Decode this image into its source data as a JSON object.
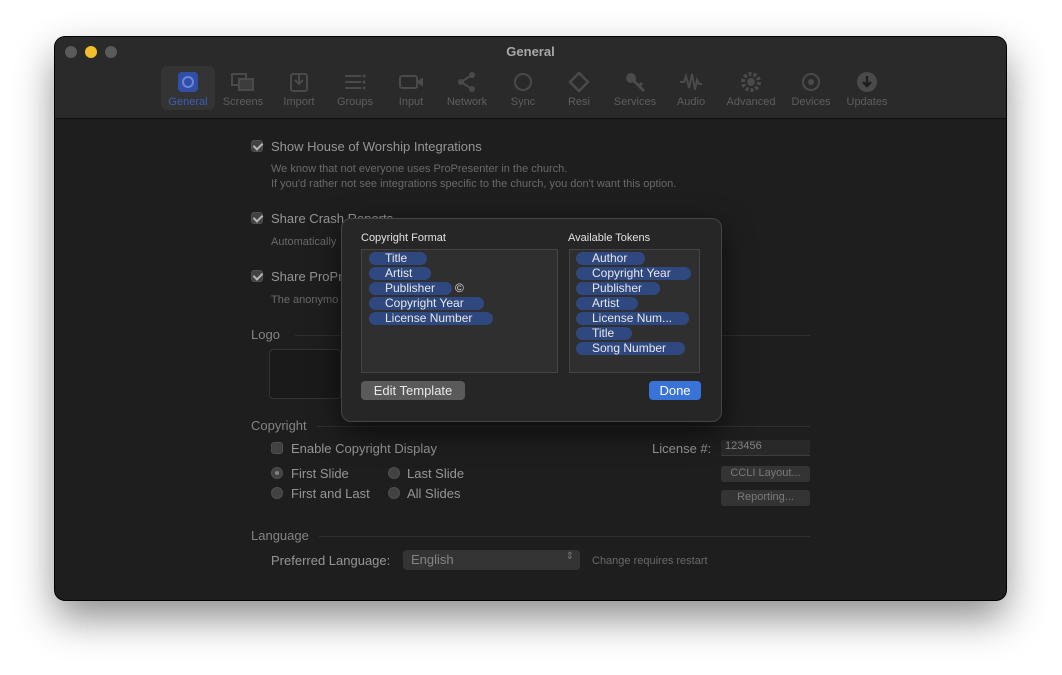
{
  "window": {
    "title": "General"
  },
  "toolbar": {
    "items": [
      {
        "label": "General",
        "icon": "gear-square-icon",
        "selected": true
      },
      {
        "label": "Screens",
        "icon": "screens-icon"
      },
      {
        "label": "Import",
        "icon": "import-icon"
      },
      {
        "label": "Groups",
        "icon": "groups-icon"
      },
      {
        "label": "Input",
        "icon": "video-input-icon"
      },
      {
        "label": "Network",
        "icon": "network-icon"
      },
      {
        "label": "Sync",
        "icon": "sync-icon"
      },
      {
        "label": "Resi",
        "icon": "resi-icon"
      },
      {
        "label": "Services",
        "icon": "key-icon"
      },
      {
        "label": "Audio",
        "icon": "waveform-icon"
      },
      {
        "label": "Advanced",
        "icon": "gear-icon"
      },
      {
        "label": "Devices",
        "icon": "devices-icon"
      },
      {
        "label": "Updates",
        "icon": "download-icon"
      }
    ]
  },
  "general": {
    "house_of_worship": {
      "label": "Show House of Worship Integrations",
      "checked": true,
      "desc1": "We know that not everyone uses ProPresenter in the church.",
      "desc2": "If you'd rather not see integrations specific to the church, you don't want this option."
    },
    "crash_reports": {
      "label": "Share Crash Reports",
      "checked": true,
      "desc": "Automatically"
    },
    "share_pro": {
      "label": "Share ProPr",
      "checked": true,
      "desc": "The anonymo"
    },
    "logo": {
      "title": "Logo"
    },
    "copyright": {
      "title": "Copyright",
      "enable_label": "Enable Copyright Display",
      "license_label": "License #:",
      "license_value": "123456",
      "first_slide": "First Slide",
      "last_slide": "Last Slide",
      "first_and_last": "First and Last",
      "all_slides": "All Slides",
      "ccli_layout": "CCLI Layout...",
      "reporting": "Reporting..."
    },
    "language": {
      "title": "Language",
      "preferred_label": "Preferred Language:",
      "value": "English",
      "note": "Change requires restart"
    }
  },
  "dialog": {
    "format_label": "Copyright Format",
    "tokens_label": "Available Tokens",
    "format_tokens": [
      "Title",
      "Artist",
      "Publisher",
      "Copyright Year",
      "License Number"
    ],
    "copyright_symbol": "©",
    "available_tokens": [
      "Author",
      "Copyright Year",
      "Publisher",
      "Artist",
      "License Num...",
      "Title",
      "Song Number"
    ],
    "edit_template": "Edit Template",
    "done": "Done"
  },
  "colors": {
    "accent": "#3a73d8",
    "token": "#2f4880"
  }
}
